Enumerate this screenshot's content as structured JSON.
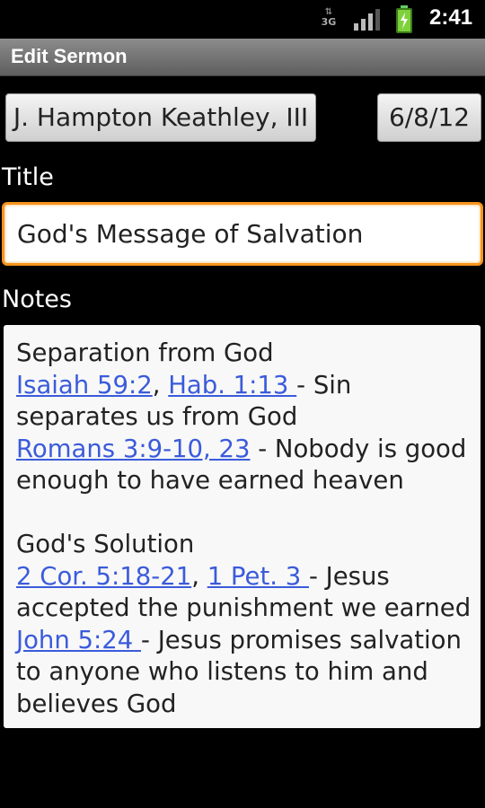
{
  "status_bar": {
    "network": "3G",
    "time": "2:41"
  },
  "title_bar": {
    "title": "Edit Sermon"
  },
  "author_button": {
    "label": "J. Hampton Keathley, III"
  },
  "date_button": {
    "label": "6/8/12"
  },
  "title_section": {
    "label": "Title",
    "value": "God's Message of Salvation"
  },
  "notes_section": {
    "label": "Notes",
    "lines": {
      "l1": "Separation from God",
      "l2_link1": "Isaiah 59:2",
      "l2_sep": ", ",
      "l2_link2": "Hab. 1:13 ",
      "l2_text": " - Sin",
      "l3": "separates us from God",
      "l4_link": "Romans 3:9-10, 23",
      "l4_text": " - Nobody is good",
      "l5": "enough to have earned heaven",
      "l7": "God's Solution",
      "l8_link1": "2 Cor. 5:18-21",
      "l8_sep": ", ",
      "l8_link2": "1 Pet. 3 ",
      "l8_text": " - Jesus",
      "l9": "accepted the punishment we earned",
      "l10_link": "John 5:24 ",
      "l10_text": " - Jesus promises salvation",
      "l11": "to anyone who listens to him and",
      "l12": "believes God"
    }
  },
  "colors": {
    "focus_border": "#f7941d",
    "link": "#3b5bdb",
    "background": "#000000"
  }
}
